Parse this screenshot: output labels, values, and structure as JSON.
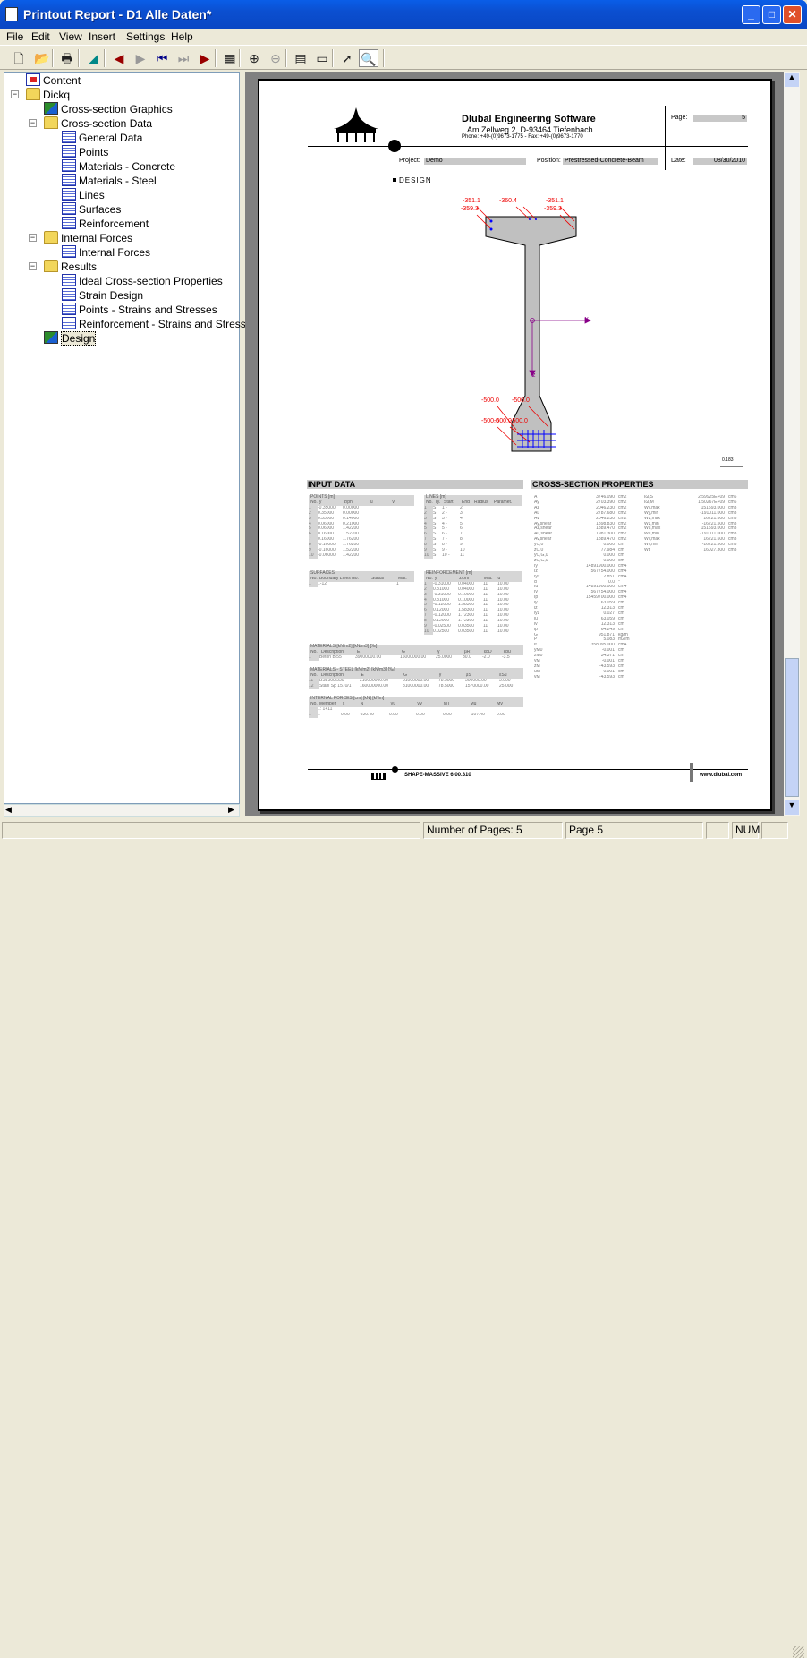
{
  "window": {
    "title": "Printout Report - D1 Alle Daten*",
    "accent": "#0a5ee8"
  },
  "menu": [
    "File",
    "Edit",
    "View",
    "Insert",
    "Settings",
    "Help"
  ],
  "toolbar": [
    {
      "icon": "new-icon"
    },
    {
      "icon": "open-icon"
    },
    {
      "icon": "print-icon"
    },
    {
      "icon": "graphic-icon"
    },
    {
      "icon": "previous-page-icon"
    },
    {
      "icon": "next-page-icon"
    },
    {
      "icon": "first-page-icon"
    },
    {
      "icon": "last-page-icon"
    },
    {
      "icon": "goto-page-icon"
    },
    {
      "icon": "page-layout-icon"
    },
    {
      "icon": "zoom-in-icon"
    },
    {
      "icon": "zoom-out-icon"
    },
    {
      "icon": "properties-icon"
    },
    {
      "icon": "header-icon"
    },
    {
      "icon": "select-icon"
    },
    {
      "icon": "zoom-area-icon"
    }
  ],
  "tree": [
    {
      "label": "Content",
      "level": 0,
      "icon": "content"
    },
    {
      "label": "Dickq",
      "level": 0,
      "icon": "fold"
    },
    {
      "label": "Cross-section Graphics",
      "level": 1,
      "icon": "gfx"
    },
    {
      "label": "Cross-section Data",
      "level": 1,
      "icon": "fold"
    },
    {
      "label": "General Data",
      "level": 2,
      "icon": "doc"
    },
    {
      "label": "Points",
      "level": 2,
      "icon": "doc"
    },
    {
      "label": "Materials - Concrete",
      "level": 2,
      "icon": "doc"
    },
    {
      "label": "Materials - Steel",
      "level": 2,
      "icon": "doc"
    },
    {
      "label": "Lines",
      "level": 2,
      "icon": "doc"
    },
    {
      "label": "Surfaces",
      "level": 2,
      "icon": "doc"
    },
    {
      "label": "Reinforcement",
      "level": 2,
      "icon": "doc"
    },
    {
      "label": "Internal Forces",
      "level": 1,
      "icon": "fold"
    },
    {
      "label": "Internal Forces",
      "level": 2,
      "icon": "doc"
    },
    {
      "label": "Results",
      "level": 1,
      "icon": "fold"
    },
    {
      "label": "Ideal Cross-section Properties",
      "level": 2,
      "icon": "doc"
    },
    {
      "label": "Strain Design",
      "level": 2,
      "icon": "doc"
    },
    {
      "label": "Points - Strains and Stresses",
      "level": 2,
      "icon": "doc"
    },
    {
      "label": "Reinforcement - Strains and Stresses",
      "level": 2,
      "icon": "doc"
    },
    {
      "label": "Design",
      "level": 1,
      "icon": "gfx",
      "selected": true
    }
  ],
  "page": {
    "company": "Dlubal Engineering Software",
    "address": "Am Zellweg 2, D-93464 Tiefenbach",
    "phone": "Phone: +49-(0)9673-1775 - Fax: +49-(0)9673-1770",
    "page_label": "Page:",
    "page_value": "5",
    "project_label": "Project:",
    "project_value": "Demo",
    "position_label": "Position:",
    "position_value": "Prestressed-Concrete-Beam",
    "date_label": "Date:",
    "date_value": "08/30/2010",
    "section": "DESIGN",
    "stress_labels": [
      "-351.1",
      "-359.3",
      "-360.4",
      "-351.1",
      "-359.3",
      "-500.0",
      "-500.0",
      "-500.0",
      "-500.0",
      "-500.0"
    ],
    "axis_y": "y",
    "axis_z": "z",
    "scale": "0.183",
    "input_title": "INPUT DATA",
    "props_title": "CROSS-SECTION PROPERTIES",
    "footer_program": "SHAPE-MASSIVE 6.00.310",
    "footer_url": "www.dlubal.com"
  },
  "tables": {
    "points": {
      "title": "POINTS [m]",
      "cols": [
        "No.",
        "y",
        "z/phi",
        "u",
        "v"
      ],
      "rows": [
        [
          "1",
          "-0.35000",
          "0.00000"
        ],
        [
          "2",
          "0.35000",
          "0.00000"
        ],
        [
          "3",
          "0.35000",
          "0.14000"
        ],
        [
          "4",
          "0.06000",
          "0.21000"
        ],
        [
          "5",
          "0.06000",
          "1.42200"
        ],
        [
          "6",
          "0.16000",
          "1.52200"
        ],
        [
          "7",
          "0.16000",
          "1.76200"
        ],
        [
          "8",
          "-0.16000",
          "1.76200"
        ],
        [
          "9",
          "-0.16000",
          "1.52200"
        ],
        [
          "10",
          "-0.06000",
          "1.42200"
        ]
      ]
    },
    "lines": {
      "title": "LINES [m]",
      "cols": [
        "No.",
        "Ty.",
        "Start",
        "End",
        "Radius",
        "Paramet."
      ],
      "rows": [
        [
          "1",
          "S",
          "1 -",
          "2"
        ],
        [
          "2",
          "S",
          "2 -",
          "3"
        ],
        [
          "3",
          "S",
          "3 -",
          "4"
        ],
        [
          "4",
          "S",
          "4 -",
          "5"
        ],
        [
          "5",
          "S",
          "5 -",
          "6"
        ],
        [
          "6",
          "S",
          "6 -",
          "7"
        ],
        [
          "7",
          "S",
          "7 -",
          "8"
        ],
        [
          "8",
          "S",
          "8 -",
          "9"
        ],
        [
          "9",
          "S",
          "9 -",
          "10"
        ],
        [
          "10",
          "S",
          "10 -",
          "11"
        ]
      ]
    },
    "surfaces": {
      "title": "SURFACES",
      "cols": [
        "No.",
        "Boundary Lines No.",
        "Status",
        "Mat."
      ],
      "rows": [
        [
          "1",
          "1-12",
          "I",
          "1"
        ]
      ]
    },
    "reinforcement": {
      "title": "REINFORCEMENT [m]",
      "cols": [
        "No.",
        "y",
        "z/phi",
        "Mat.",
        "d"
      ],
      "rows": [
        [
          "1",
          "-0.31000",
          "0.04000",
          "11",
          "10.00"
        ],
        [
          "2",
          "0.31000",
          "0.04000",
          "11",
          "10.00"
        ],
        [
          "3",
          "-0.31000",
          "0.10000",
          "11",
          "10.00"
        ],
        [
          "4",
          "0.31000",
          "0.10000",
          "11",
          "10.00"
        ],
        [
          "5",
          "-0.12000",
          "1.58300",
          "11",
          "10.00"
        ],
        [
          "6",
          "0.12000",
          "1.58300",
          "11",
          "10.00"
        ],
        [
          "7",
          "-0.12000",
          "1.72300",
          "11",
          "10.00"
        ],
        [
          "8",
          "0.12000",
          "1.72300",
          "11",
          "10.00"
        ],
        [
          "9",
          "-0.02500",
          "0.03500",
          "11",
          "10.00"
        ],
        [
          "10",
          "0.02500",
          "0.03500",
          "11",
          "10.00"
        ]
      ]
    },
    "materials": {
      "title": "MATERIALS [kN/m2] [kN/m3] [‰]",
      "cols": [
        "No.",
        "Description",
        "E",
        "G",
        "γ",
        "βR",
        "εbD",
        "εbu"
      ],
      "rows": [
        [
          "1",
          "Beton B 55",
          "39000000.00",
          "16000000.00",
          "25.0000",
          "30.0",
          "-2.0",
          "-3.5"
        ]
      ]
    },
    "steel": {
      "title": "MATERIALS - STEEL [kN/m2] [kN/m3] [‰]",
      "cols": [
        "No.",
        "Description",
        "E",
        "G",
        "γ",
        "βS",
        "εSu"
      ],
      "rows": [
        [
          "11",
          "BSt 500/550",
          "210000000.00",
          "81000000.00",
          "78.5000",
          "500000.00",
          "5.000"
        ],
        [
          "12",
          "Stahl Sp 1570/1",
          "160000000.00",
          "81000000.00",
          "78.5000",
          "1570000.00",
          "25.000"
        ]
      ]
    },
    "forces": {
      "title": "INTERNAL FORCES [cm] [kN] [kNm]",
      "cols": [
        "No.",
        "Member",
        "x",
        "N",
        "Vu",
        "Vv",
        "MT",
        "Mu",
        "Mv"
      ],
      "rows": [
        [
          "",
          "1: 1+11"
        ],
        [
          "1",
          "1",
          "0.00",
          "-920.49",
          "0.00",
          "0.00",
          "0.00",
          "-107.40",
          "0.00"
        ]
      ]
    },
    "props1": [
      [
        "A",
        "3746.090",
        "cm2"
      ],
      [
        "Ay",
        "2703.390",
        "cm2"
      ],
      [
        "Az",
        "2046.230",
        "cm2"
      ],
      [
        "Au",
        "2787.680",
        "cm2"
      ],
      [
        "Av",
        "2046.230",
        "cm2"
      ],
      [
        "Ay,shear",
        "1898.830",
        "cm2"
      ],
      [
        "Az,shear",
        "1889.470",
        "cm2"
      ],
      [
        "Au,shear",
        "1981.300",
        "cm2"
      ],
      [
        "Av,shear",
        "1889.470",
        "cm2"
      ],
      [
        "yC,0",
        "0.000",
        "cm"
      ],
      [
        "zC,0",
        "77.984",
        "cm"
      ],
      [
        "yC,G,0",
        "0.000",
        "cm"
      ],
      [
        "zC,G,0",
        "0.000",
        "cm"
      ],
      [
        "Iy",
        "14891900.000",
        "cm4"
      ],
      [
        "Iz",
        "567754.000",
        "cm4"
      ],
      [
        "Iyz",
        "2.851",
        "cm4"
      ],
      [
        "α",
        "0.0",
        "°"
      ],
      [
        "Iu",
        "14891900.000",
        "cm4"
      ],
      [
        "Iv",
        "567754.000",
        "cm4"
      ],
      [
        "Ip",
        "15459700.000",
        "cm4"
      ],
      [
        "iy",
        "63.059",
        "cm"
      ],
      [
        "iz",
        "12.313",
        "cm"
      ],
      [
        "iyz",
        "0.027",
        "cm"
      ],
      [
        "iu",
        "63.059",
        "cm"
      ],
      [
        "iv",
        "12.313",
        "cm"
      ],
      [
        "ip",
        "64.249",
        "cm"
      ],
      [
        "G",
        "951.871",
        "kg/m"
      ],
      [
        "P",
        "5.083",
        "m2/m"
      ],
      [
        "It",
        "358095.000",
        "cm4"
      ],
      [
        "yM0",
        "-0.001",
        "cm"
      ],
      [
        "zM0",
        "34.371",
        "cm"
      ],
      [
        "yM",
        "-0.001",
        "cm"
      ],
      [
        "zM",
        "-43.593",
        "cm"
      ],
      [
        "uM",
        "-0.001",
        "cm"
      ],
      [
        "vM",
        "-43.593",
        "cm"
      ]
    ],
    "props2": [
      [
        "Iω,S",
        "2.59925E+09",
        "cm6"
      ],
      [
        "Iω,M",
        "1.50267E+09",
        "cm6"
      ],
      [
        "Wy,max",
        "151593.000",
        "cm3"
      ],
      [
        "Wy,min",
        "-191011.000",
        "cm3"
      ],
      [
        "Wz,max",
        "16221.600",
        "cm3"
      ],
      [
        "Wz,min",
        "-16221.500",
        "cm3"
      ],
      [
        "Wu,max",
        "151593.000",
        "cm3"
      ],
      [
        "Wu,min",
        "-191011.000",
        "cm3"
      ],
      [
        "Wv,max",
        "16221.600",
        "cm3"
      ],
      [
        "Wv,min",
        "-16221.500",
        "cm3"
      ],
      [
        "Wt",
        "16027.300",
        "cm3"
      ]
    ]
  },
  "status": {
    "pages": "Number of Pages: 5",
    "page": "Page 5",
    "num": "NUM"
  }
}
